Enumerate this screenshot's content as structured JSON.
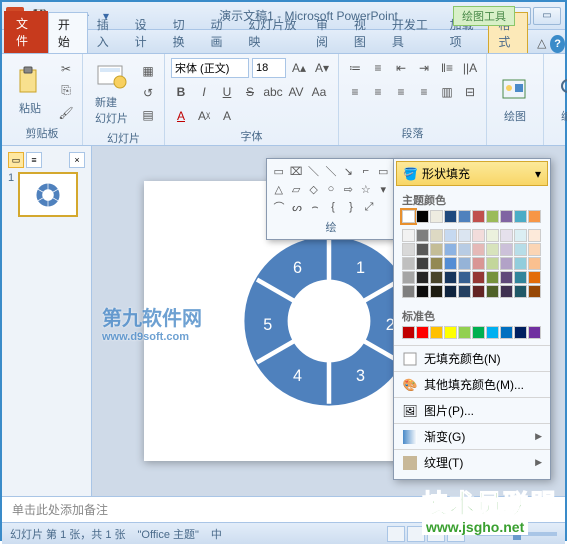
{
  "titlebar": {
    "app_letter": "P",
    "title": "演示文稿1 - Microsoft PowerPoint",
    "context_tool": "绘图工具"
  },
  "tabs": {
    "file": "文件",
    "home": "开始",
    "insert": "插入",
    "design": "设计",
    "transitions": "切换",
    "animations": "动画",
    "slideshow": "幻灯片放映",
    "review": "审阅",
    "view": "视图",
    "developer": "开发工具",
    "addins": "加载项",
    "format": "格式"
  },
  "ribbon": {
    "clipboard": {
      "label": "剪贴板",
      "paste": "粘贴"
    },
    "slides": {
      "label": "幻灯片",
      "new_slide": "新建\n幻灯片"
    },
    "font": {
      "label": "字体",
      "name": "宋体 (正文)",
      "size": "18"
    },
    "paragraph": {
      "label": "段落"
    },
    "drawing": {
      "label": "绘图",
      "btn": "绘图"
    },
    "editing": {
      "label": "编辑",
      "btn": "编辑"
    },
    "shape_gallery_label": "绘"
  },
  "fill_dropdown": {
    "button": "形状填充",
    "theme_label": "主题颜色",
    "standard_label": "标准色",
    "no_fill": "无填充颜色(N)",
    "more_colors": "其他填充颜色(M)...",
    "picture": "图片(P)...",
    "gradient": "渐变(G)",
    "texture": "纹理(T)",
    "theme_row1": [
      "#ffffff",
      "#000000",
      "#eeece1",
      "#1f497d",
      "#4f81bd",
      "#c0504d",
      "#9bbb59",
      "#8064a2",
      "#4bacc6",
      "#f79646"
    ],
    "theme_tints": [
      [
        "#f2f2f2",
        "#7f7f7f",
        "#ddd9c3",
        "#c6d9f0",
        "#dbe5f1",
        "#f2dcdb",
        "#ebf1dd",
        "#e5e0ec",
        "#dbeef3",
        "#fdeada"
      ],
      [
        "#d8d8d8",
        "#595959",
        "#c4bd97",
        "#8db3e2",
        "#b8cce4",
        "#e5b9b7",
        "#d7e3bc",
        "#ccc1d9",
        "#b7dde8",
        "#fbd5b5"
      ],
      [
        "#bfbfbf",
        "#3f3f3f",
        "#938953",
        "#548dd4",
        "#95b3d7",
        "#d99694",
        "#c3d69b",
        "#b2a2c7",
        "#92cddc",
        "#fac08f"
      ],
      [
        "#a5a5a5",
        "#262626",
        "#494429",
        "#17365d",
        "#366092",
        "#953734",
        "#76923c",
        "#5f497a",
        "#31859b",
        "#e36c09"
      ],
      [
        "#7f7f7f",
        "#0c0c0c",
        "#1d1b10",
        "#0f243e",
        "#244061",
        "#632423",
        "#4f6128",
        "#3f3151",
        "#205867",
        "#974806"
      ]
    ],
    "standard_colors": [
      "#c00000",
      "#ff0000",
      "#ffc000",
      "#ffff00",
      "#92d050",
      "#00b050",
      "#00b0f0",
      "#0070c0",
      "#002060",
      "#7030a0"
    ]
  },
  "slide": {
    "thumb_number": "1",
    "segments": [
      "1",
      "2",
      "3",
      "4",
      "5",
      "6"
    ]
  },
  "notes": {
    "placeholder": "单击此处添加备注"
  },
  "statusbar": {
    "slide_info": "幻灯片 第 1 张，共 1 张",
    "theme": "\"Office 主题\"",
    "lang": "中"
  },
  "watermarks": {
    "w1_main": "第九软件网",
    "w1_sub": "www.d9soft.com",
    "w2_main": "技术员联盟",
    "w2_sub": "www.jsgho.net"
  },
  "chart_data": {
    "type": "pie",
    "title": "",
    "categories": [
      "1",
      "2",
      "3",
      "4",
      "5",
      "6"
    ],
    "values": [
      1,
      1,
      1,
      1,
      1,
      1
    ],
    "note": "donut ring with 6 equal segments labeled 1-6, all same color #4f81bd"
  }
}
